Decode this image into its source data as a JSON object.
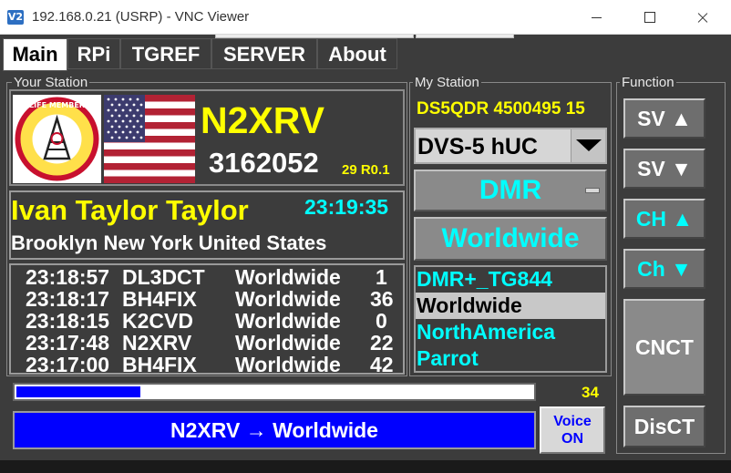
{
  "window": {
    "title": "192.168.0.21 (USRP) - VNC Viewer",
    "icon_text": "V2"
  },
  "tabs": [
    {
      "label": "Main",
      "active": true
    },
    {
      "label": "RPi",
      "active": false
    },
    {
      "label": "TGREF",
      "active": false
    },
    {
      "label": "SERVER",
      "active": false
    },
    {
      "label": "About",
      "active": false
    }
  ],
  "your_station": {
    "label": "Your Station",
    "callsign": "N2XRV",
    "id": "3162052",
    "extra": "29 R0.1",
    "name": "Ivan Taylor Taylor",
    "time": "23:19:35",
    "location": "Brooklyn New York United States",
    "logo_text": "LIFE MEMBER"
  },
  "log": [
    {
      "time": "23:18:57",
      "call": "DL3DCT",
      "tg": "Worldwide",
      "num": "1"
    },
    {
      "time": "23:18:17",
      "call": "BH4FIX",
      "tg": "Worldwide",
      "num": "36"
    },
    {
      "time": "23:18:15",
      "call": "K2CVD",
      "tg": "Worldwide",
      "num": "0"
    },
    {
      "time": "23:17:48",
      "call": "N2XRV",
      "tg": "Worldwide",
      "num": "22"
    },
    {
      "time": "23:17:00",
      "call": "BH4FIX",
      "tg": "Worldwide",
      "num": "42"
    }
  ],
  "progress": {
    "value": 34,
    "label": "34",
    "fraction": 0.24
  },
  "status_bar": {
    "text": "N2XRV → Worldwide"
  },
  "voice": {
    "line1": "Voice",
    "line2": "ON"
  },
  "my_station": {
    "label": "My Station",
    "info": "DS5QDR 4500495 15",
    "device": "DVS-5 hUC",
    "mode": "DMR",
    "talkgroup": "Worldwide",
    "list": [
      "DMR+_TG844",
      "Worldwide",
      "NorthAmerica",
      "Parrot"
    ],
    "selected_index": 1
  },
  "function": {
    "label": "Function",
    "buttons": [
      {
        "label": "SV ▲",
        "color": "#ffffff"
      },
      {
        "label": "SV ▼",
        "color": "#ffffff"
      },
      {
        "label": "CH ▲",
        "color": "#00ffff"
      },
      {
        "label": "Ch ▼",
        "color": "#00ffff"
      }
    ],
    "connect": "CNCT",
    "disconnect": "DisCT"
  },
  "colors": {
    "background": "#3c3c3c",
    "callsign": "#ffff00",
    "accent_cyan": "#00ffff",
    "status_blue": "#0000ff"
  }
}
